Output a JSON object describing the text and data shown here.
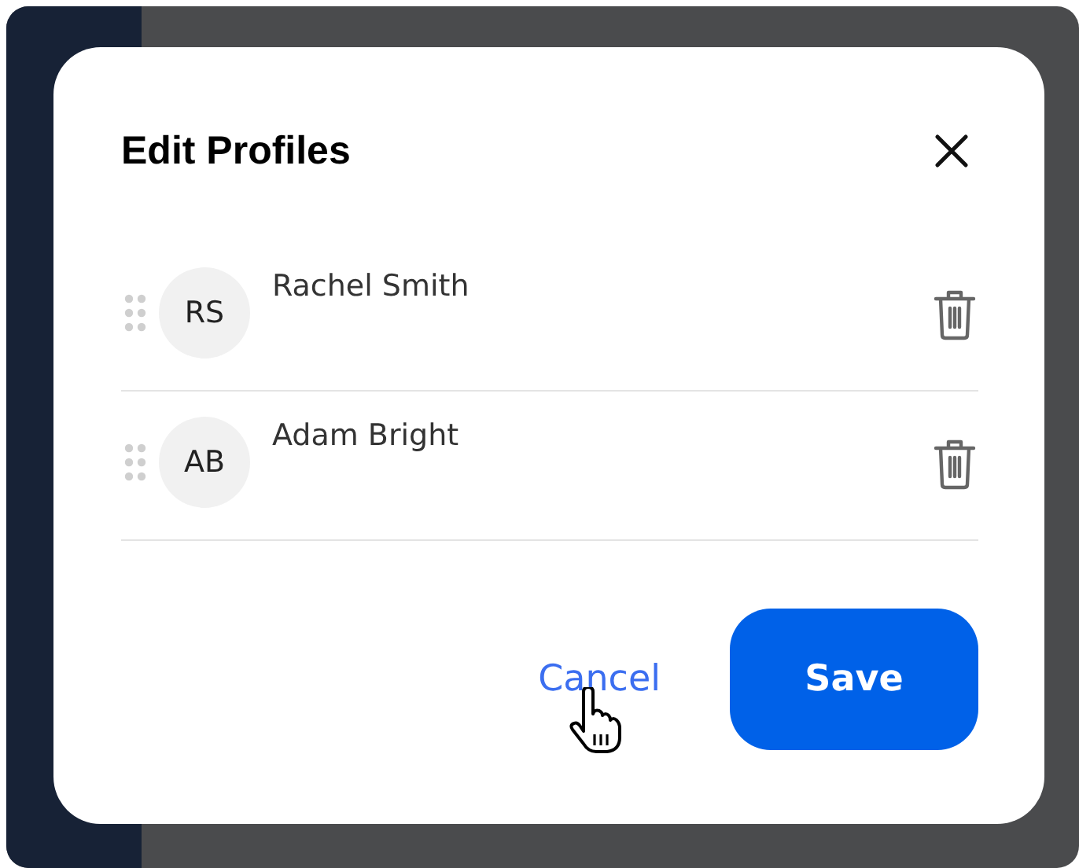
{
  "dialog": {
    "title": "Edit Profiles",
    "profiles": [
      {
        "initials": "RS",
        "name": "Rachel Smith"
      },
      {
        "initials": "AB",
        "name": "Adam Bright"
      }
    ],
    "buttons": [
      {
        "label": "Cancel",
        "kind": "link",
        "hovered": true
      },
      {
        "label": "Save",
        "kind": "primary",
        "hovered": false
      }
    ]
  }
}
